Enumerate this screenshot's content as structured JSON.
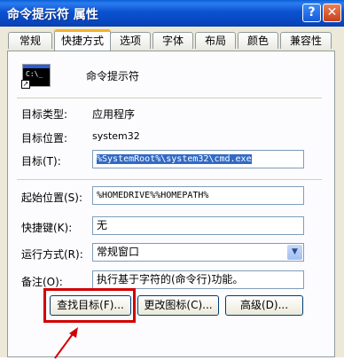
{
  "window": {
    "title": "命令提示符 属性",
    "help_glyph": "?",
    "close_glyph": "✕"
  },
  "tabs": [
    {
      "label": "常规",
      "active": false
    },
    {
      "label": "快捷方式",
      "active": true
    },
    {
      "label": "选项",
      "active": false
    },
    {
      "label": "字体",
      "active": false
    },
    {
      "label": "布局",
      "active": false
    },
    {
      "label": "颜色",
      "active": false
    },
    {
      "label": "兼容性",
      "active": false
    }
  ],
  "shortcut": {
    "icon_text": "C:\\_",
    "name": "命令提示符",
    "target_type_label": "目标类型:",
    "target_type_value": "应用程序",
    "target_location_label": "目标位置:",
    "target_location_value": "system32",
    "target_label": "目标(T):",
    "target_value": "%SystemRoot%\\system32\\cmd.exe",
    "start_in_label": "起始位置(S):",
    "start_in_value": "%HOMEDRIVE%%HOMEPATH%",
    "hotkey_label": "快捷键(K):",
    "hotkey_value": "无",
    "run_label": "运行方式(R):",
    "run_value": "常规窗口",
    "comment_label": "备注(O):",
    "comment_value": "执行基于字符的(命令行)功能。"
  },
  "buttons": {
    "find_target": "查找目标(F)...",
    "change_icon": "更改图标(C)...",
    "advanced": "高级(D)..."
  },
  "colors": {
    "title_bar": "#0a52d0",
    "dialog_bg": "#ece9d8",
    "tab_accent": "#f4b130",
    "annotation": "#d00000",
    "selection": "#316ac5"
  }
}
